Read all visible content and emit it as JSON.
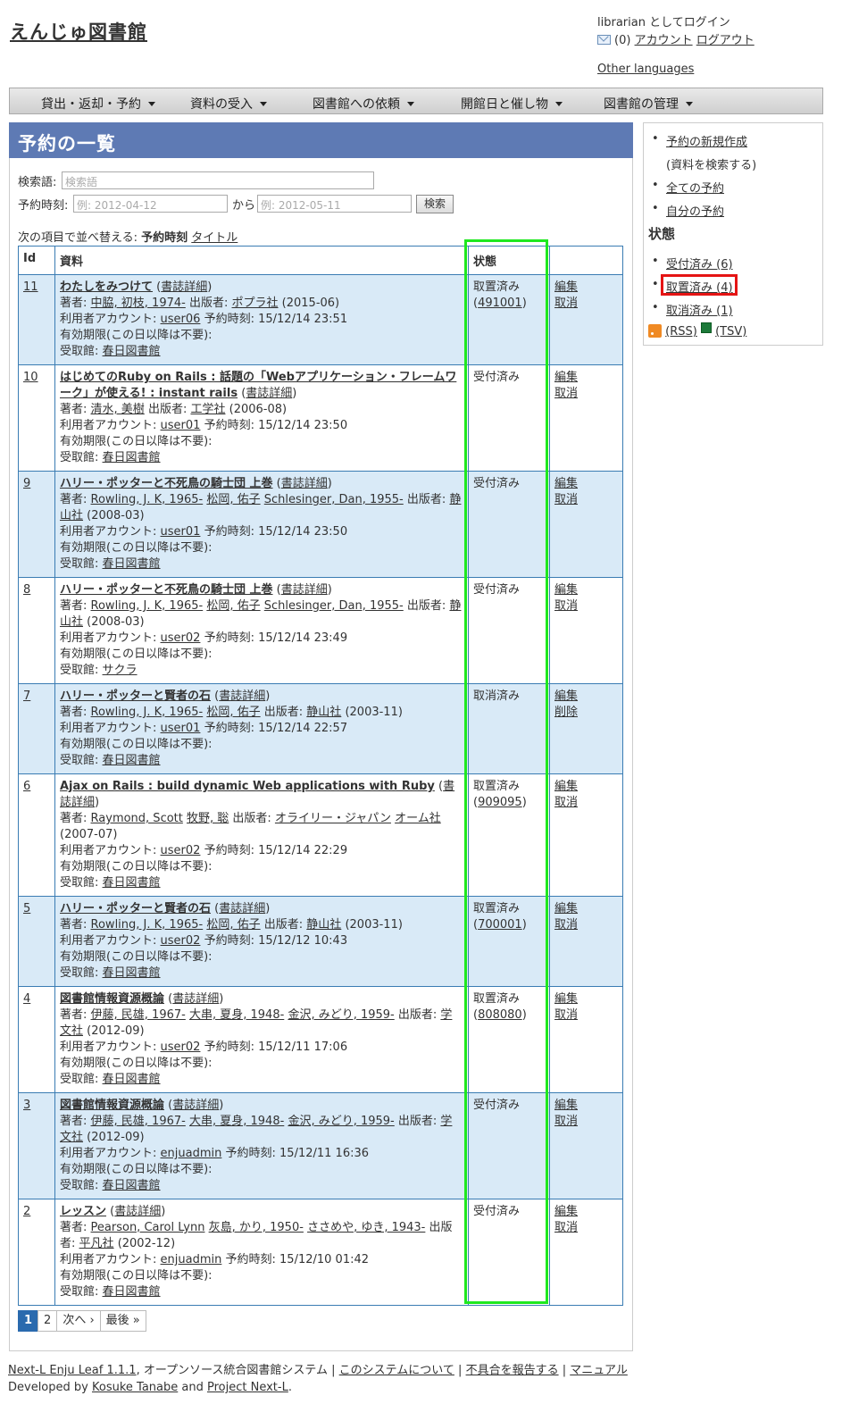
{
  "site_title": "えんじゅ図書館",
  "user": {
    "login_text": "librarian としてログイン",
    "msg_count": "(0)",
    "account": "アカウント",
    "logout": "ログアウト",
    "other_languages": "Other languages"
  },
  "menu": [
    "貸出・返却・予約",
    "資料の受入",
    "図書館への依頼",
    "開館日と催し物",
    "図書館の管理"
  ],
  "page_title": "予約の一覧",
  "form": {
    "search_label": "検索語:",
    "search_placeholder": "検索語",
    "period_label": "予約時刻:",
    "from_placeholder": "例: 2012-04-12",
    "kara": "から",
    "to_placeholder": "例: 2012-05-11",
    "search_button": "検索"
  },
  "sort": {
    "label": "次の項目で並べ替える:",
    "current": "予約時刻",
    "alt": "タイトル"
  },
  "table": {
    "headers": [
      "Id",
      "資料",
      "状態",
      ""
    ],
    "rows": [
      {
        "id": "11",
        "title": "わたしをみつけて",
        "detail": "書誌詳細",
        "authors": [
          "中脇, 初枝, 1974-"
        ],
        "publishers": [
          "ポプラ社"
        ],
        "date": "(2015-06)",
        "user": "user06",
        "time": "15/12/14 23:51",
        "library": "春日図書館",
        "status": "取置済み",
        "item": "491001",
        "edit": "編集",
        "action": "取消"
      },
      {
        "id": "10",
        "title": "はじめてのRuby on Rails : 話題の「Webアプリケーション・フレームワーク」が使える! : instant rails",
        "detail": "書誌詳細",
        "authors": [
          "清水, 美樹"
        ],
        "publishers": [
          "工学社"
        ],
        "date": "(2006-08)",
        "user": "user01",
        "time": "15/12/14 23:50",
        "library": "春日図書館",
        "status": "受付済み",
        "item": "",
        "edit": "編集",
        "action": "取消"
      },
      {
        "id": "9",
        "title": "ハリー・ポッターと不死鳥の騎士団 上巻",
        "detail": "書誌詳細",
        "authors": [
          "Rowling, J. K, 1965-",
          "松岡, 佑子",
          "Schlesinger, Dan, 1955-"
        ],
        "publishers": [
          "静山社"
        ],
        "date": "(2008-03)",
        "user": "user01",
        "time": "15/12/14 23:50",
        "library": "春日図書館",
        "status": "受付済み",
        "item": "",
        "edit": "編集",
        "action": "取消"
      },
      {
        "id": "8",
        "title": "ハリー・ポッターと不死鳥の騎士団 上巻",
        "detail": "書誌詳細",
        "authors": [
          "Rowling, J. K, 1965-",
          "松岡, 佑子",
          "Schlesinger, Dan, 1955-"
        ],
        "publishers": [
          "静山社"
        ],
        "date": "(2008-03)",
        "user": "user02",
        "time": "15/12/14 23:49",
        "library": "サクラ",
        "status": "受付済み",
        "item": "",
        "edit": "編集",
        "action": "取消"
      },
      {
        "id": "7",
        "title": "ハリー・ポッターと賢者の石",
        "detail": "書誌詳細",
        "authors": [
          "Rowling, J. K, 1965-",
          "松岡, 佑子"
        ],
        "publishers": [
          "静山社"
        ],
        "date": "(2003-11)",
        "user": "user01",
        "time": "15/12/14 22:57",
        "library": "春日図書館",
        "status": "取消済み",
        "item": "",
        "edit": "編集",
        "action": "削除"
      },
      {
        "id": "6",
        "title": "Ajax on Rails : build dynamic Web applications with Ruby",
        "detail": "書誌詳細",
        "authors": [
          "Raymond, Scott",
          "牧野, 聡"
        ],
        "publishers": [
          "オライリー・ジャパン",
          "オーム社"
        ],
        "date": "(2007-07)",
        "user": "user02",
        "time": "15/12/14 22:29",
        "library": "春日図書館",
        "status": "取置済み",
        "item": "909095",
        "edit": "編集",
        "action": "取消"
      },
      {
        "id": "5",
        "title": "ハリー・ポッターと賢者の石",
        "detail": "書誌詳細",
        "authors": [
          "Rowling, J. K, 1965-",
          "松岡, 佑子"
        ],
        "publishers": [
          "静山社"
        ],
        "date": "(2003-11)",
        "user": "user02",
        "time": "15/12/12 10:43",
        "library": "春日図書館",
        "status": "取置済み",
        "item": "700001",
        "edit": "編集",
        "action": "取消"
      },
      {
        "id": "4",
        "title": "図書館情報資源概論",
        "detail": "書誌詳細",
        "authors": [
          "伊藤, 民雄, 1967-",
          "大串, 夏身, 1948-",
          "金沢, みどり, 1959-"
        ],
        "publishers": [
          "学文社"
        ],
        "date": "(2012-09)",
        "user": "user02",
        "time": "15/12/11 17:06",
        "library": "春日図書館",
        "status": "取置済み",
        "item": "808080",
        "edit": "編集",
        "action": "取消"
      },
      {
        "id": "3",
        "title": "図書館情報資源概論",
        "detail": "書誌詳細",
        "authors": [
          "伊藤, 民雄, 1967-",
          "大串, 夏身, 1948-",
          "金沢, みどり, 1959-"
        ],
        "publishers": [
          "学文社"
        ],
        "date": "(2012-09)",
        "user": "enjuadmin",
        "time": "15/12/11 16:36",
        "library": "春日図書館",
        "status": "受付済み",
        "item": "",
        "edit": "編集",
        "action": "取消"
      },
      {
        "id": "2",
        "title": "レッスン",
        "detail": "書誌詳細",
        "authors": [
          "Pearson, Carol Lynn",
          "灰島, かり, 1950-",
          "ささめや, ゆき, 1943-"
        ],
        "publishers": [
          "平凡社"
        ],
        "date": "(2002-12)",
        "user": "enjuadmin",
        "time": "15/12/10 01:42",
        "library": "春日図書館",
        "status": "受付済み",
        "item": "",
        "edit": "編集",
        "action": "取消"
      }
    ],
    "labels": {
      "author": "著者:",
      "publisher": "出版者:",
      "user": "利用者アカウント:",
      "time": "予約時刻:",
      "expire": "有効期限(この日以降は不要):",
      "library": "受取館:"
    }
  },
  "pager": [
    "1",
    "2",
    "次へ ›",
    "最後 »"
  ],
  "sidebar": {
    "new": "予約の新規作成",
    "new_sub": "(資料を検索する)",
    "all": "全ての予約",
    "mine": "自分の予約",
    "status_title": "状態",
    "statuses": [
      "受付済み (6)",
      "取置済み (4)",
      "取消済み (1)"
    ],
    "rss": "(RSS)",
    "tsv": "(TSV)"
  },
  "footer": {
    "product": "Next-L Enju Leaf 1.1.1",
    "desc": ", オープンソース統合図書館システム",
    "about": "このシステムについて",
    "report": "不具合を報告する",
    "manual": "マニュアル",
    "dev_by": "Developed by",
    "author1": "Kosuke Tanabe",
    "and": "and",
    "author2": "Project Next-L"
  }
}
